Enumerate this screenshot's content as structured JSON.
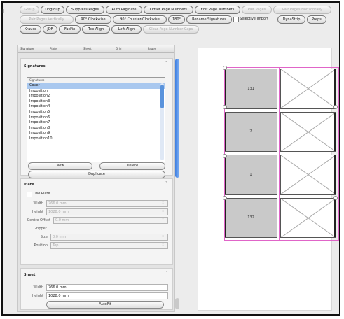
{
  "toolbar": {
    "row1": [
      "Group",
      "Ungroup",
      "Suppress Pages",
      "Auto Paginate",
      "Offset Page Numbers",
      "Edit Page Numbers",
      "Pair Pages",
      "Pair Pages Horizontally"
    ],
    "row1_disabled": [
      true,
      false,
      false,
      false,
      false,
      false,
      true,
      true
    ],
    "row2": [
      "Pair Pages Vertically",
      "90° Clockwise",
      "90° Counter-Clockwise",
      "180°",
      "Rename Signatures"
    ],
    "row2_disabled": [
      true,
      false,
      false,
      false,
      false
    ],
    "selective_import_label": "Selective Import",
    "row2b": [
      "DynaStrip",
      "Preps"
    ],
    "row3": [
      "Krause",
      "JDF",
      "FacFix",
      "Top Align",
      "Left Align",
      "Clear Page Number Caps"
    ],
    "row3_disabled": [
      false,
      false,
      false,
      false,
      false,
      true
    ]
  },
  "columns": [
    "Signature",
    "Plate",
    "Sheet",
    "Grid",
    "Pages"
  ],
  "signatures": {
    "title": "Signatures",
    "list_header": "Signatures",
    "items": [
      "Cover",
      "Imposition",
      "Imposition2",
      "Imposition3",
      "Imposition4",
      "Imposition5",
      "Imposition6",
      "Imposition7",
      "Imposition8",
      "Imposition9",
      "Imposition10"
    ],
    "selected_index": 0,
    "new_label": "New",
    "delete_label": "Delete",
    "duplicate_label": "Duplicate"
  },
  "plate": {
    "title": "Plate",
    "use_plate_label": "Use Plate",
    "width_label": "Width",
    "width_value": "766.0 mm",
    "height_label": "Height",
    "height_value": "1028.0 mm",
    "centre_offset_label": "Centre Offset",
    "centre_offset_value": "0.0 mm",
    "gripper_label": "Gripper",
    "size_label": "Size",
    "size_value": "0.0 mm",
    "position_label": "Position",
    "position_value": "Top"
  },
  "sheet": {
    "title": "Sheet",
    "width_label": "Width",
    "width_value": "766.0 mm",
    "height_label": "Height",
    "height_value": "1028.0 mm",
    "autofit_label": "AutoFit"
  },
  "pages": [
    {
      "num": "131",
      "filled": true
    },
    {
      "num": "",
      "filled": false
    },
    {
      "num": "2",
      "filled": true
    },
    {
      "num": "",
      "filled": false
    },
    {
      "num": "1",
      "filled": true
    },
    {
      "num": "",
      "filled": false
    },
    {
      "num": "132",
      "filled": true
    },
    {
      "num": "",
      "filled": false
    }
  ],
  "colors": {
    "selection": "#a9c8ef",
    "scroll_accent": "#3f7fe0",
    "page_frame": "#e065c8",
    "page_fill": "#c9c9c9"
  }
}
